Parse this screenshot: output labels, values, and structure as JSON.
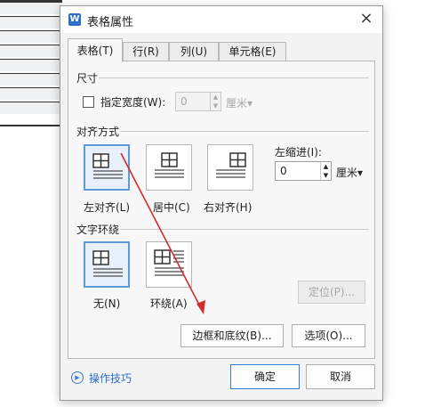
{
  "dialog": {
    "title": "表格属性",
    "app_icon_letter": "W",
    "close_glyph": "×"
  },
  "tabs": [
    {
      "label": "表格(T)",
      "active": true
    },
    {
      "label": "行(R)",
      "active": false
    },
    {
      "label": "列(U)",
      "active": false
    },
    {
      "label": "单元格(E)",
      "active": false
    }
  ],
  "size": {
    "group_label": "尺寸",
    "width_checkbox_label": "指定宽度(W):",
    "width_checked": false,
    "width_value": "0",
    "width_unit": "厘米▾"
  },
  "alignment": {
    "group_label": "对齐方式",
    "options": [
      {
        "label": "左对齐(L)",
        "selected": true
      },
      {
        "label": "居中(C)",
        "selected": false
      },
      {
        "label": "右对齐(H)",
        "selected": false
      }
    ],
    "indent_label": "左缩进(I):",
    "indent_value": "0",
    "indent_unit": "厘米▾"
  },
  "wrapping": {
    "group_label": "文字环绕",
    "options": [
      {
        "label": "无(N)",
        "selected": true
      },
      {
        "label": "环绕(A)",
        "selected": false
      }
    ],
    "position_button": "定位(P)..."
  },
  "buttons": {
    "borders": "边框和底纹(B)...",
    "options": "选项(O)...",
    "ok": "确定",
    "cancel": "取消"
  },
  "footer": {
    "tips_label": "操作技巧"
  },
  "colors": {
    "accent": "#3b7ad0",
    "selected_border": "#5d9ad6",
    "annotation_arrow": "#d42a2a"
  },
  "icons": {
    "app": "wps-writer-icon",
    "close": "close-icon",
    "tips": "play-circle-icon",
    "spin": "spin-arrows-icon",
    "annotation": "red-arrow-annotation"
  }
}
